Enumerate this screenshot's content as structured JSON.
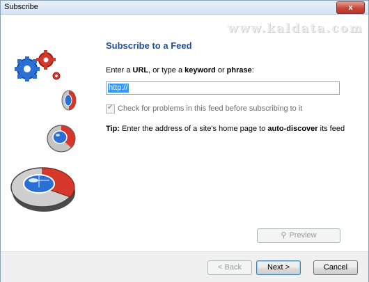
{
  "window": {
    "title": "Subscribe",
    "close_glyph": "x"
  },
  "watermark": "www.kaldata.com",
  "heading": "Subscribe to a Feed",
  "prompt": {
    "part1": "Enter a ",
    "url": "URL",
    "part2": ", or type a ",
    "keyword": "keyword",
    "part3": " or ",
    "phrase": "phrase",
    "part4": ":"
  },
  "url_field": {
    "value": "http://"
  },
  "check": {
    "label": "Check for problems in this feed before subscribing to it",
    "checked": true,
    "enabled": false
  },
  "tip": {
    "label": "Tip:",
    "part1": " Enter the address of a site's home page to ",
    "emphasis": "auto-discover",
    "part2": " its feed"
  },
  "buttons": {
    "preview": "Preview",
    "back": "< Back",
    "next": "Next >",
    "cancel": "Cancel"
  },
  "icons": {
    "preview": "magnifier-icon",
    "illustration": "feed-gears-and-discs"
  },
  "colors": {
    "heading": "#1f4e9a",
    "accent_red": "#d6372b",
    "accent_blue": "#2a6fd4"
  }
}
